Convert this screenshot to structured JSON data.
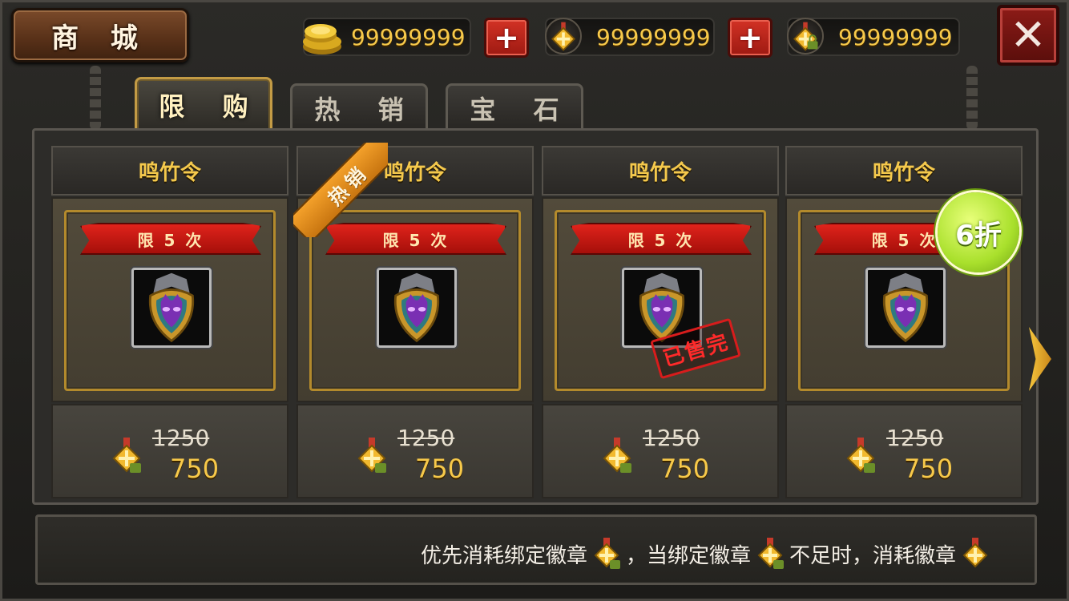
{
  "header": {
    "title": "商 城",
    "gold_value": "99999999",
    "badge_value": "99999999",
    "bound_badge_value": "99999999",
    "plus_label": "+",
    "close_label": "✕"
  },
  "tabs": [
    {
      "label": "限 购",
      "active": true
    },
    {
      "label": "热 销",
      "active": false
    },
    {
      "label": "宝 石",
      "active": false
    }
  ],
  "items": [
    {
      "name": "鸣竹令",
      "limit": "限 5 次",
      "old_price": "1250",
      "new_price": "750"
    },
    {
      "name": "鸣竹令",
      "limit": "限 5 次",
      "old_price": "1250",
      "new_price": "750"
    },
    {
      "name": "鸣竹令",
      "limit": "限 5 次",
      "old_price": "1250",
      "new_price": "750"
    },
    {
      "name": "鸣竹令",
      "limit": "限 5 次",
      "old_price": "1250",
      "new_price": "750"
    }
  ],
  "labels": {
    "hot": "热销",
    "sold_out": "已售完",
    "discount": "6折"
  },
  "footer": {
    "part1": "优先消耗绑定徽章",
    "part2": "，当绑定徽章",
    "part3": "不足时，消耗徽章"
  },
  "colors": {
    "gold_text": "#f7c94a",
    "tab_active_border": "#c39b45",
    "ribbon_red": "#e0231b",
    "discount_green": "#a9e02c"
  },
  "icons": [
    "gold-coins-icon",
    "badge-icon",
    "bound-badge-icon",
    "plus-icon",
    "close-icon",
    "arrow-right-icon"
  ]
}
